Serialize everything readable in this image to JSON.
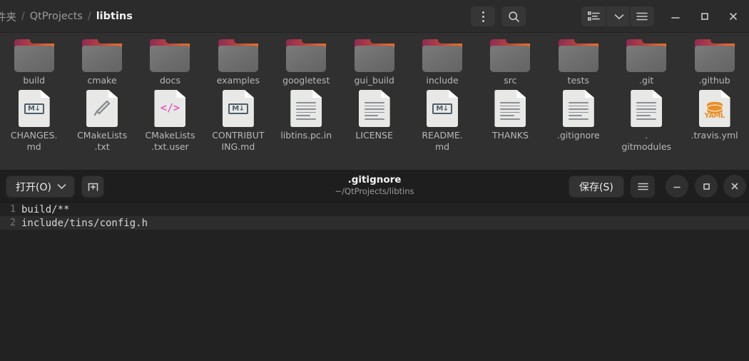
{
  "file_manager": {
    "breadcrumb": [
      {
        "label": "件夹",
        "current": false
      },
      {
        "label": "QtProjects",
        "current": false
      },
      {
        "label": "libtins",
        "current": true
      }
    ],
    "separator": "/",
    "toolbar": {
      "kebab_icon": "kebab-menu-icon",
      "search_icon": "search-icon",
      "list_view_icon": "list-view-icon",
      "view_dropdown_icon": "chevron-down-icon",
      "main_menu_icon": "hamburger-menu-icon",
      "minimize_icon": "minimize-icon",
      "maximize_icon": "maximize-icon",
      "close_icon": "close-icon"
    },
    "items": [
      {
        "name": "build",
        "type": "folder"
      },
      {
        "name": "cmake",
        "type": "folder"
      },
      {
        "name": "docs",
        "type": "folder"
      },
      {
        "name": "examples",
        "type": "folder"
      },
      {
        "name": "googletest",
        "type": "folder"
      },
      {
        "name": "gui_build",
        "type": "folder"
      },
      {
        "name": "include",
        "type": "folder"
      },
      {
        "name": "src",
        "type": "folder"
      },
      {
        "name": "tests",
        "type": "folder"
      },
      {
        "name": ".git",
        "type": "folder"
      },
      {
        "name": ".github",
        "type": "folder"
      },
      {
        "name": "CHANGES.\nmd",
        "type": "markdown"
      },
      {
        "name": "CMakeLists\n.txt",
        "type": "cmake"
      },
      {
        "name": "CMakeLists\n.txt.user",
        "type": "xml"
      },
      {
        "name": "CONTRIBUT\nING.md",
        "type": "markdown"
      },
      {
        "name": "libtins.pc.in",
        "type": "text"
      },
      {
        "name": "LICENSE",
        "type": "text"
      },
      {
        "name": "README.\nmd",
        "type": "markdown"
      },
      {
        "name": "THANKS",
        "type": "text"
      },
      {
        "name": ".gitignore",
        "type": "text"
      },
      {
        "name": ".\ngitmodules",
        "type": "text"
      },
      {
        "name": ".travis.yml",
        "type": "yaml"
      }
    ]
  },
  "editor": {
    "open_button": "打开(O)",
    "new_tab_icon": "new-document-icon",
    "title": ".gitignore",
    "subtitle": "~/QtProjects/libtins",
    "save_button": "保存(S)",
    "menu_icon": "hamburger-menu-icon",
    "minimize_icon": "minimize-icon",
    "maximize_icon": "maximize-icon",
    "close_icon": "close-icon",
    "lines": [
      {
        "number": "1",
        "text": "build/**",
        "current": false
      },
      {
        "number": "2",
        "text": "include/tins/config.h",
        "current": true
      }
    ]
  },
  "colors": {
    "fm_background": "#303030",
    "fm_headerbar": "#2b2b2b",
    "editor_background": "#222222",
    "editor_headerbar": "#1e1e1e",
    "current_line": "#2d2d2d",
    "folder_accent_start": "#8c2b55",
    "folder_accent_end": "#ef6c27",
    "xml_accent": "#e05ec0",
    "yaml_accent": "#e8902b"
  }
}
